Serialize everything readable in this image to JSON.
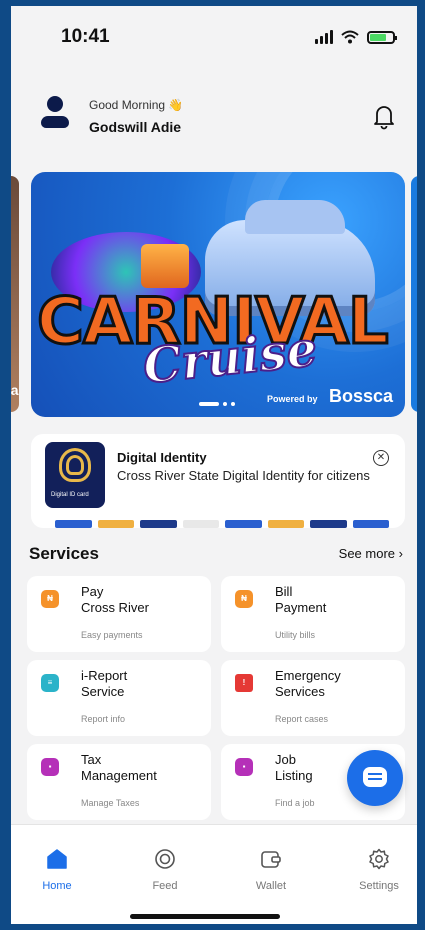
{
  "status_bar": {
    "time": "10:41"
  },
  "header": {
    "greeting": "Good Morning",
    "greeting_emoji": "👋",
    "user_name": "Godswill Adie"
  },
  "banner": {
    "title_word_1": "CARNIVAL",
    "title_word_2": "Cruise",
    "powered_by": "Powered by",
    "sponsor": "Bossca",
    "prev_card_text": "ca"
  },
  "identity_card": {
    "title": "Digital Identity",
    "description": "Cross River State Digital Identity for citizens",
    "logo_caption": "Digital ID card"
  },
  "services": {
    "title": "Services",
    "see_more": "See more",
    "items": [
      {
        "title": "Pay\nCross River",
        "subtitle": "Easy payments",
        "icon": "wallet-icon",
        "icon_text": "₦",
        "color": "#f5922a"
      },
      {
        "title": "Bill\nPayment",
        "subtitle": "Utility bills",
        "icon": "bill-icon",
        "icon_text": "₦",
        "color": "#f5922a"
      },
      {
        "title": "i-Report\nService",
        "subtitle": "Report info",
        "icon": "report-icon",
        "icon_text": "≡",
        "color": "#2bb3c9"
      },
      {
        "title": "Emergency\nServices",
        "subtitle": "Report cases",
        "icon": "warning-icon",
        "icon_text": "!",
        "color": "#e53935"
      },
      {
        "title": "Tax\nManagement",
        "subtitle": "Manage Taxes",
        "icon": "tax-icon",
        "icon_text": "▪",
        "color": "#b530b8"
      },
      {
        "title": "Job\nListing",
        "subtitle": "Find a job",
        "icon": "job-icon",
        "icon_text": "▪",
        "color": "#b530b8"
      }
    ]
  },
  "tabbar": {
    "home": "Home",
    "feed": "Feed",
    "wallet": "Wallet",
    "settings": "Settings"
  },
  "colors": {
    "accent": "#1c6ee8",
    "frame": "#0f4a86",
    "background": "#f3f3f4"
  }
}
